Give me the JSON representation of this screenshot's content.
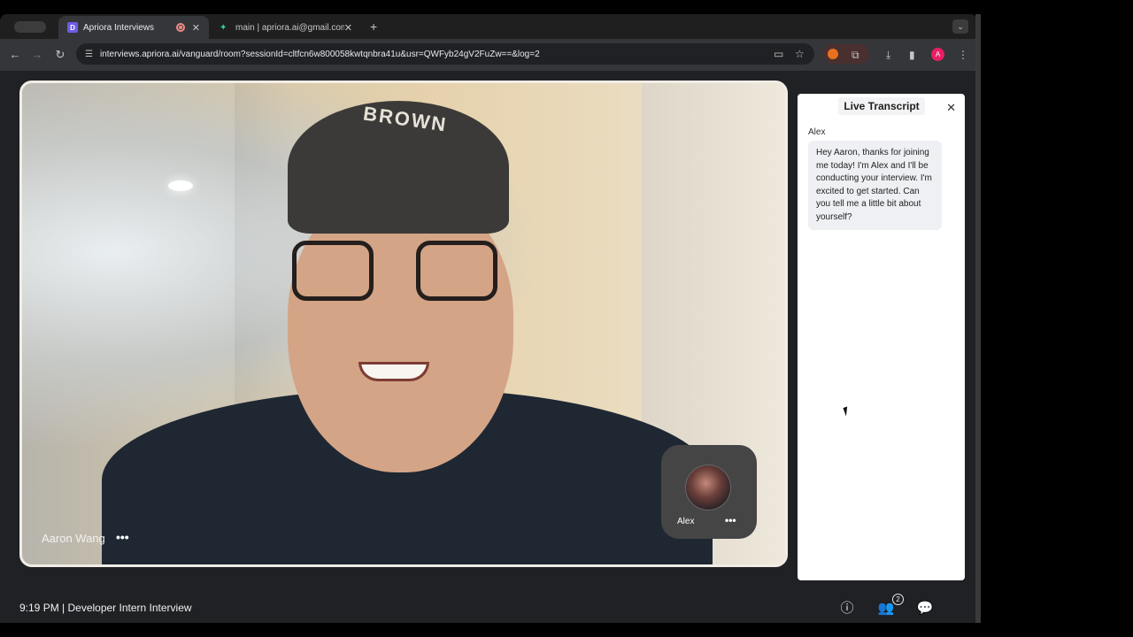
{
  "browser": {
    "tabs": [
      {
        "title": "Apriora Interviews",
        "active": true
      },
      {
        "title": "main | apriora.ai@gmail.com",
        "active": false
      }
    ],
    "url": "interviews.apriora.ai/vanguard/room?sessionId=cltfcn6w800058kwtqnbra41u&usr=QWFyb24gV2FuZw==&log=2",
    "profile_initial": "A"
  },
  "video": {
    "participant_name": "Aaron Wang",
    "cap_text": "BROWN",
    "pip_name": "Alex"
  },
  "transcript": {
    "title": "Live Transcript",
    "speaker": "Alex",
    "message": "Hey Aaron, thanks for joining me today! I'm Alex and I'll be conducting your interview. I'm excited to get started. Can you tell me a little bit about yourself?"
  },
  "footer": {
    "info": "9:19 PM | Developer Intern Interview",
    "participants_count": "2"
  },
  "icons": {
    "info": "info-icon",
    "participants": "participants-icon",
    "chat": "chat-icon"
  }
}
